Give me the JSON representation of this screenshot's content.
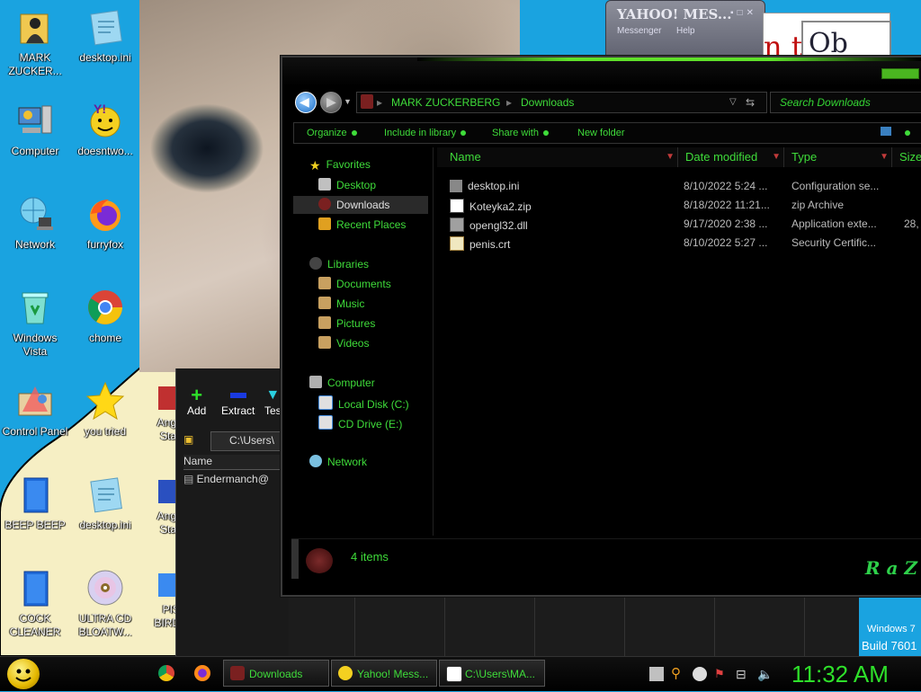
{
  "desktop": {
    "icons": [
      {
        "label": "MARK ZUCKER...",
        "icon": "user-folder-icon"
      },
      {
        "label": "desktop.ini",
        "icon": "ini-file-icon"
      },
      {
        "label": "Computer",
        "icon": "computer-icon"
      },
      {
        "label": "doesntwo...",
        "icon": "yahoo-icon"
      },
      {
        "label": "Network",
        "icon": "network-icon"
      },
      {
        "label": "furryfox",
        "icon": "firefox-icon"
      },
      {
        "label": "Windows Vista",
        "icon": "recycle-bin-icon"
      },
      {
        "label": "chome",
        "icon": "chrome-icon"
      },
      {
        "label": "Control Panel",
        "icon": "control-panel-icon"
      },
      {
        "label": "you tried",
        "icon": "star-icon"
      },
      {
        "label": "BEEP BEEP",
        "icon": "blue-file-icon"
      },
      {
        "label": "desktop.ini",
        "icon": "ini-file-icon"
      },
      {
        "label": "COCK CLEANER",
        "icon": "blue-file-icon"
      },
      {
        "label": "ULTRA CD BLOATW...",
        "icon": "cd-icon"
      }
    ],
    "partial_icons": [
      {
        "label": "Angr Star",
        "icon": "game-icon"
      },
      {
        "label": "Angr Star",
        "icon": "game-icon"
      },
      {
        "label": "PIS BIRD",
        "icon": "game-icon"
      }
    ]
  },
  "yahoo_window": {
    "title": "YAHOO! MES...",
    "menu_messenger": "Messenger",
    "menu_help": "Help"
  },
  "archive_window": {
    "add": "Add",
    "extract": "Extract",
    "test": "Tes",
    "address": "C:\\Users\\",
    "name_col": "Name",
    "row": "Endermanch@"
  },
  "explorer": {
    "breadcrumb": [
      "MARK ZUCKERBERG",
      "Downloads"
    ],
    "search_placeholder": "Search Downloads",
    "commands": [
      "Organize",
      "Include in library",
      "Share with",
      "New folder"
    ],
    "nav": {
      "favorites": "Favorites",
      "desktop": "Desktop",
      "downloads": "Downloads",
      "recent": "Recent Places",
      "libraries": "Libraries",
      "documents": "Documents",
      "music": "Music",
      "pictures": "Pictures",
      "videos": "Videos",
      "computer": "Computer",
      "local_disk": "Local Disk (C:)",
      "cd_drive": "CD Drive (E:)",
      "network": "Network"
    },
    "columns": {
      "name": "Name",
      "date": "Date modified",
      "type": "Type",
      "size": "Size"
    },
    "files": [
      {
        "name": "desktop.ini",
        "date": "8/10/2022 5:24 ...",
        "type": "Configuration se...",
        "size": "",
        "icon": "ini-file-icon"
      },
      {
        "name": "Koteyka2.zip",
        "date": "8/18/2022 11:21...",
        "type": "zip Archive",
        "size": "",
        "icon": "zip-file-icon"
      },
      {
        "name": "opengl32.dll",
        "date": "9/17/2020 2:38 ...",
        "type": "Application exte...",
        "size": "28,",
        "icon": "dll-file-icon"
      },
      {
        "name": "penis.crt",
        "date": "8/10/2022 5:27 ...",
        "type": "Security Certific...",
        "size": "",
        "icon": "certificate-icon"
      }
    ],
    "status": "4 items",
    "brand": "R a Z"
  },
  "watermark": {
    "line1": "Windows 7",
    "line2": "Build 7601"
  },
  "taskbar": {
    "tasks": [
      {
        "label": "Downloads",
        "icon": "folder-icon"
      },
      {
        "label": "Yahoo! Mess...",
        "icon": "yahoo-icon"
      },
      {
        "label": "C:\\Users\\MA...",
        "icon": "archive-icon"
      }
    ],
    "clock": "11:32 AM"
  },
  "colors": {
    "accent_green": "#3fdc3a",
    "desktop_blue": "#1aa3e0"
  }
}
